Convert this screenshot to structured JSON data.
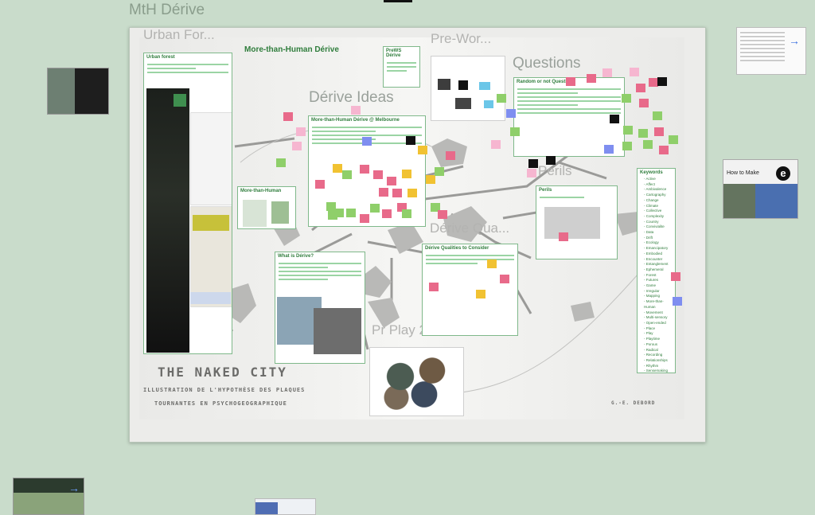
{
  "board_title": "MtH Dérive",
  "frames": {
    "urban_forest": "Urban For...",
    "pre_work": "Pre-Wor...",
    "questions": "Questions",
    "derive_ideas": "Dérive Ideas",
    "derive_qualities": "Dérive Qua...",
    "perils": "Perils",
    "preplay": "Pr Play 20..."
  },
  "cards": {
    "urban_forest": "Urban forest",
    "mth_derive": "More-than-Human Dérive",
    "prews": "PreWS Dérive",
    "random_q": "Random or not Questions",
    "mth_melbourne": "More-than-Human Dérive @ Melbourne",
    "more_than_human": "More-than-Human",
    "what_is_derive": "What is Dérive?",
    "qualities": "Dérive Qualities to Consider",
    "perils": "Perils",
    "keywords": "Keywords"
  },
  "keywords": [
    "Active",
    "Affect",
    "Ambivalence",
    "Cartography",
    "Change",
    "Climate",
    "Collective",
    "Complexity",
    "Country",
    "Convivialite",
    "Data",
    "Drift",
    "Ecology",
    "Emancipatory",
    "Embodied",
    "Encounter",
    "Entanglement",
    "Ephemeral",
    "Forest",
    "Futures",
    "Game",
    "Irregular",
    "Mapping",
    "More-than-Human",
    "Movement",
    "Multi-sensory",
    "Open-ended",
    "Place",
    "Play",
    "Playtime",
    "Porous",
    "Radical",
    "Recording",
    "Relationships",
    "Rhythm",
    "Sensemaking",
    "Sensing Data",
    "Slow",
    "Speed",
    "Tensions",
    "Threshold",
    "Terrain",
    "Transformation",
    "Urban",
    "..."
  ],
  "naked_city": {
    "title": "THE NAKED CITY",
    "line1": "ILLUSTRATION DE L'HYPOTHÈSE DES PLAQUES",
    "line2": "TOURNANTES EN PSYCHOGEOGRAPHIQUE",
    "credit": "G.-E. DEBORD"
  },
  "side_text": {
    "how_to_make": "How to Make",
    "glyph": "e"
  },
  "icons": {
    "arrow": "→"
  },
  "colors": {
    "background": "#c9dccb",
    "accent_green": "#2f7d3c",
    "sticky_pink": "#e86a8a",
    "sticky_green": "#8fcf6a",
    "sticky_yellow": "#f1c232",
    "link_blue": "#3b6fe0"
  }
}
